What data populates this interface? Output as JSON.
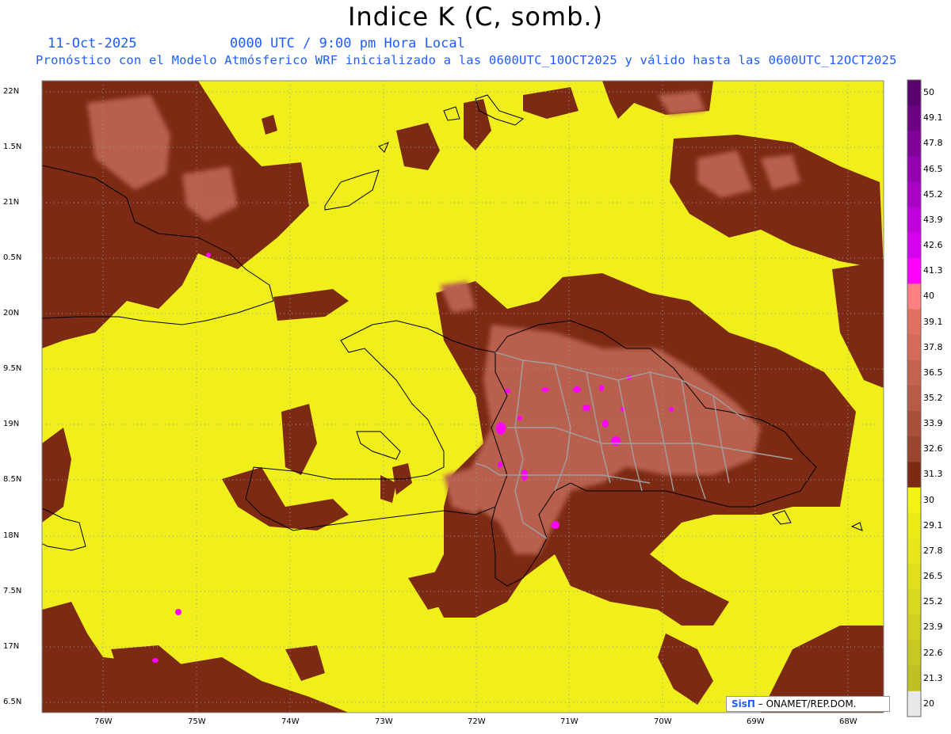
{
  "header": {
    "title": "Indice K (C, somb.)",
    "date": "11-Oct-2025",
    "time": "0000 UTC / 9:00 pm Hora Local",
    "description": "Pronóstico con el Modelo Atmósferico WRF inicializado a las 0600UTC_10OCT2025 y válido hasta las  0600UTC_12OCT2025"
  },
  "map": {
    "lat_labels": [
      "22N",
      "1.5N",
      "21N",
      "0.5N",
      "20N",
      "9.5N",
      "19N",
      "8.5N",
      "18N",
      "7.5N",
      "17N",
      "6.5N"
    ],
    "lon_labels": [
      "76W",
      "75W",
      "74W",
      "73W",
      "72W",
      "71W",
      "70W",
      "69W",
      "68W"
    ],
    "lat_range": [
      16.5,
      22.0
    ],
    "lon_range": [
      -76.6,
      -67.6
    ],
    "colors": {
      "ocean_field": "#f0ef1c",
      "low": "#7c2a14",
      "mid": "#b8614d",
      "high": "#ff00ff"
    }
  },
  "colorbar": {
    "levels": [
      "50",
      "49.1",
      "47.8",
      "46.5",
      "45.2",
      "43.9",
      "42.6",
      "41.3",
      "40",
      "39.1",
      "37.8",
      "36.5",
      "35.2",
      "33.9",
      "32.6",
      "31.3",
      "30",
      "29.1",
      "27.8",
      "26.5",
      "25.2",
      "23.9",
      "22.6",
      "21.3",
      "20"
    ],
    "colors": [
      "#5a0070",
      "#6d0085",
      "#80009a",
      "#9500b0",
      "#aa00c6",
      "#c000dc",
      "#d500ef",
      "#ff00ff",
      "#ff8080",
      "#e07060",
      "#d46b58",
      "#c46250",
      "#b85a48",
      "#a8503c",
      "#9a4530",
      "#7c2a14",
      "#f3f315",
      "#ecec17",
      "#e6e61a",
      "#dfdf1c",
      "#d8d81e",
      "#d0d020",
      "#c8c822",
      "#c0c024",
      "#e8e8e8"
    ]
  },
  "credit": {
    "brand": "SisΠ",
    "org": "– ONAMET/REP.DOM."
  }
}
